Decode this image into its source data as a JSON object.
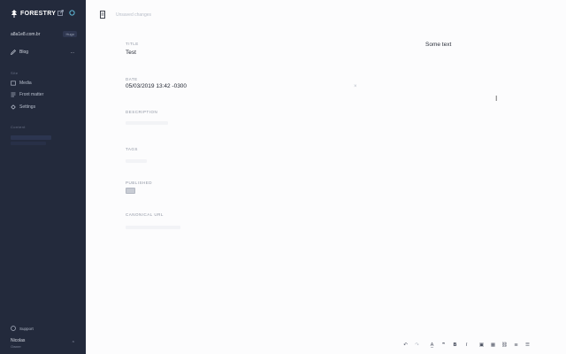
{
  "sidebar": {
    "logo_text": "FORESTRY",
    "site_name": "a8a1e8.com.br",
    "site_badge": "Hugo",
    "blog_label": "Blog",
    "blog_more": "...",
    "section_label": "Site",
    "items": [
      {
        "label": "Media",
        "icon": "image-icon"
      },
      {
        "label": "Front matter",
        "icon": "list-icon"
      },
      {
        "label": "Settings",
        "icon": "gear-icon"
      }
    ],
    "section2_label": "Content",
    "support_label": "Support",
    "user_name": "Nicolas",
    "user_sub": "Owner"
  },
  "topbar": {
    "status_text": "Unsaved changes"
  },
  "form": {
    "fields": [
      {
        "label": "TITLE",
        "value": "Test"
      },
      {
        "label": "DATE",
        "value": "05/03/2019 13:42 -0300"
      },
      {
        "label": "DESCRIPTION",
        "value": ""
      },
      {
        "label": "TAGS",
        "value": ""
      },
      {
        "label": "PUBLISHED",
        "value": ""
      },
      {
        "label": "CANONICAL URL",
        "value": ""
      }
    ],
    "clear_symbol": "×"
  },
  "editor": {
    "body_text": "Some text",
    "cursor_glyph": "I"
  },
  "toolbar": {
    "buttons": [
      {
        "label": "↶",
        "icon": "undo-icon"
      },
      {
        "label": "↷",
        "icon": "redo-icon"
      },
      {
        "label": "A̲",
        "icon": "text-style-icon"
      },
      {
        "label": "❞",
        "icon": "quote-icon"
      },
      {
        "label": "B",
        "icon": "bold-icon"
      },
      {
        "label": "I",
        "icon": "italic-icon"
      },
      {
        "label": "▣",
        "icon": "image-icon"
      },
      {
        "label": "▦",
        "icon": "table-icon"
      },
      {
        "label": "⛓",
        "icon": "link-icon"
      },
      {
        "label": "≡",
        "icon": "bullet-list-icon"
      },
      {
        "label": "☰",
        "icon": "numbered-list-icon"
      }
    ]
  },
  "colors": {
    "sidebar_bg": "#232a3c",
    "main_bg": "#fcfcfd"
  }
}
